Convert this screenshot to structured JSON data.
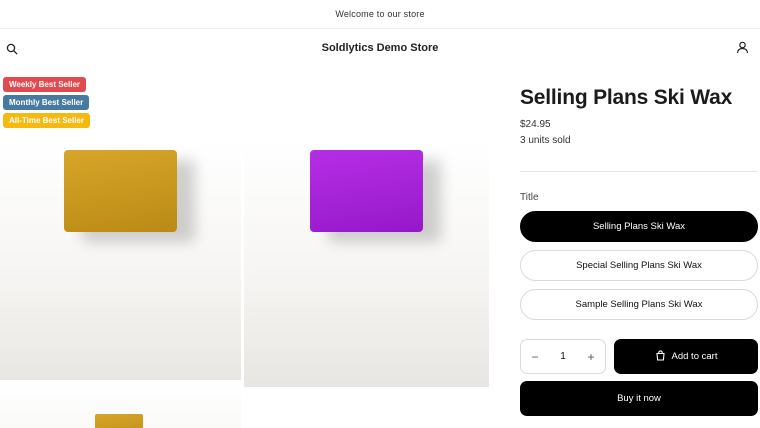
{
  "announcement": {
    "text": "Welcome to our store"
  },
  "header": {
    "store_name": "Soldlytics Demo Store",
    "search_icon": "search-icon",
    "account_icon": "user-icon"
  },
  "badges": {
    "weekly": "Weekly Best Seller",
    "monthly": "Monthly Best Seller",
    "alltime": "All-Time Best Seller",
    "colors": {
      "weekly": "#e34a50",
      "monthly": "#487aa1",
      "alltime": "#f6b90f"
    }
  },
  "product": {
    "title": "Selling Plans Ski Wax",
    "price": "$24.95",
    "units_sold": "3 units sold",
    "option_label": "Title",
    "variants": [
      {
        "label": "Selling Plans Ski Wax",
        "selected": true
      },
      {
        "label": "Special Selling Plans Ski Wax",
        "selected": false
      },
      {
        "label": "Sample Selling Plans Ski Wax",
        "selected": false
      }
    ],
    "quantity": "1",
    "decrement": "−",
    "increment": "+",
    "add_to_cart": "Add to cart",
    "buy_now": "Buy it now"
  }
}
